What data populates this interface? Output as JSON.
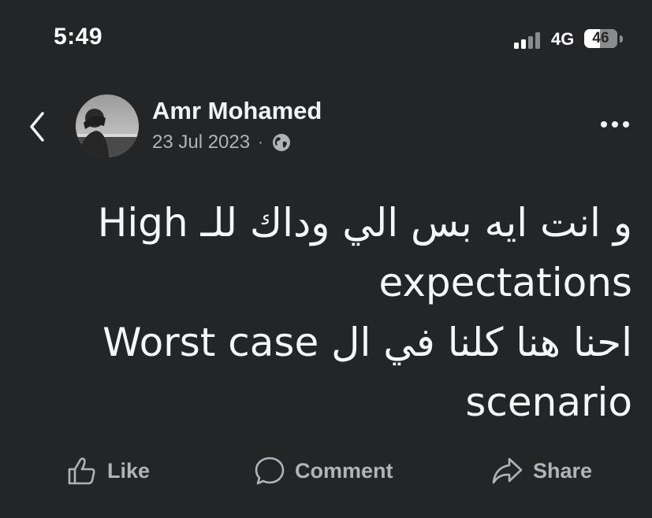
{
  "status_bar": {
    "time": "5:49",
    "network": "4G",
    "battery": "46"
  },
  "post": {
    "author": "Amr Mohamed",
    "date": "23 Jul 2023",
    "separator": "·",
    "privacy_icon": "globe-icon",
    "text_lines": [
      "و انت ايه بس الي وداك للـ High",
      "expectations",
      "احنا هنا كلنا في ال Worst case",
      "scenario"
    ]
  },
  "actions": {
    "like_label": "Like",
    "comment_label": "Comment",
    "share_label": "Share"
  },
  "colors": {
    "background": "#242526",
    "primary_text": "#e4e6eb",
    "secondary_text": "#b0b3b8"
  }
}
